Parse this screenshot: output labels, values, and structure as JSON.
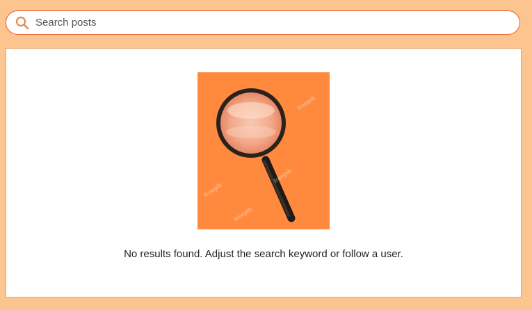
{
  "search": {
    "placeholder": "Search posts",
    "value": "",
    "icon": "search-icon"
  },
  "results": {
    "empty_message": "No results found. Adjust the search keyword or follow a user.",
    "illustration": "magnifying-glass-illustration",
    "watermark": "freepik"
  },
  "colors": {
    "page_background": "#fcc48e",
    "search_border": "#e8642c",
    "search_icon": "#e08b4c",
    "illustration_background": "#ff8a3d",
    "panel_background": "#ffffff"
  }
}
